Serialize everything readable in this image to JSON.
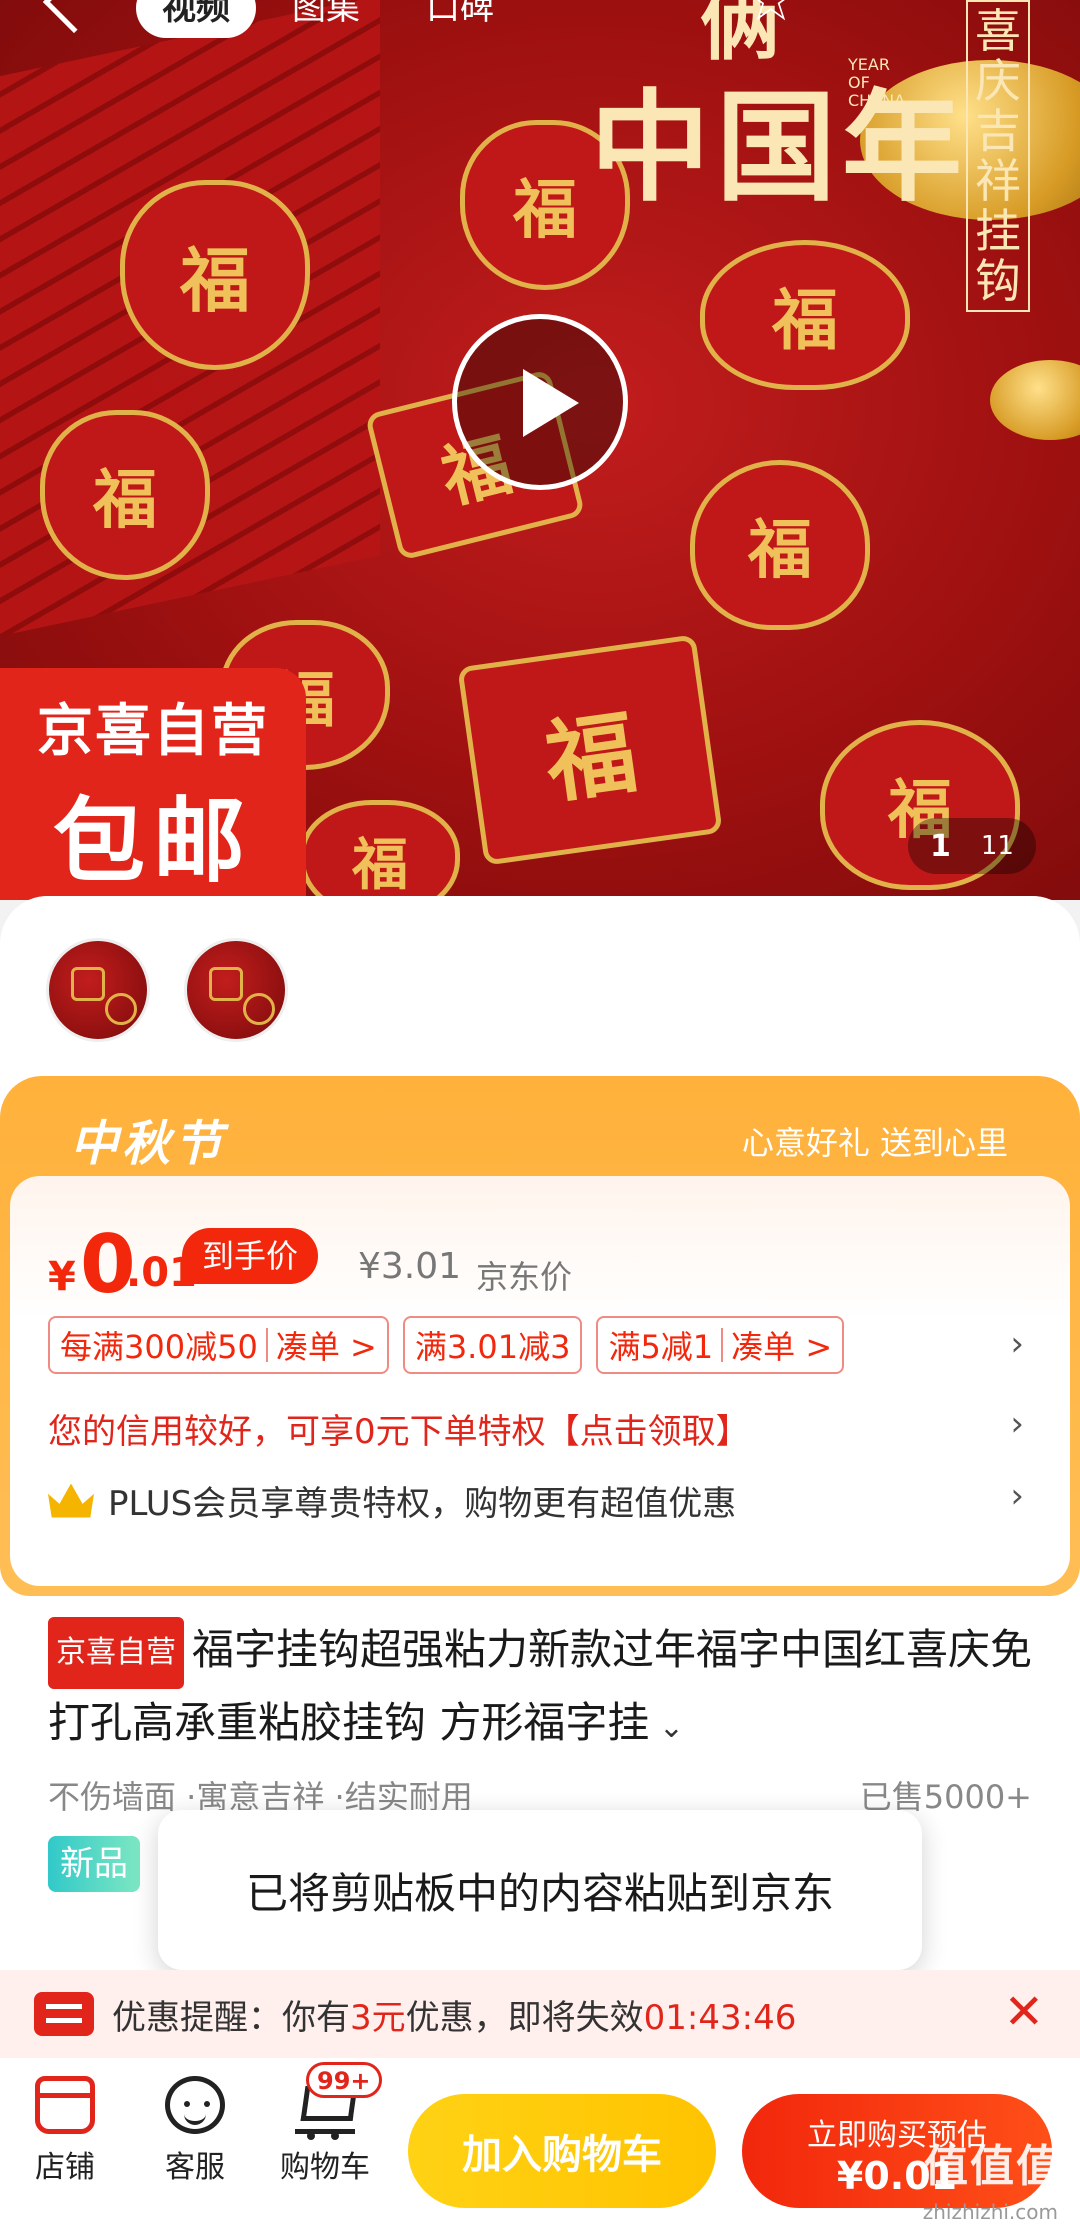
{
  "nav": {
    "tabs": [
      "视频",
      "图集",
      "口碑"
    ]
  },
  "hero": {
    "title_line1": "俩",
    "title_line2": "中国年",
    "year_text": "YEAR OF CHANA",
    "vertical_text": "喜庆吉祥挂钩",
    "fu_char": "福",
    "badge_line1": "京喜自营",
    "badge_line2": "包邮",
    "image_index": "1",
    "image_total": "11"
  },
  "festival": {
    "title": "中秋节",
    "slogan": "心意好礼 送到心里"
  },
  "price": {
    "currency": "¥",
    "integer": "0",
    "decimal": ".01",
    "tag": "到手价",
    "jd_price": "¥3.01",
    "jd_price_label": "京东价"
  },
  "coupons": [
    {
      "label": "每满300减50",
      "action": "凑单 >"
    },
    {
      "label": "满3.01减3"
    },
    {
      "label": "满5减1",
      "action": "凑单 >"
    }
  ],
  "credit_text": "您的信用较好，可享0元下单特权【点击领取】",
  "plus_text": "PLUS会员享尊贵特权，购物更有超值优惠",
  "product": {
    "tag": "京喜自营",
    "title": "福字挂钩超强粘力新款过年福字中国红喜庆免打孔高承重粘胶挂钩 方形福字挂",
    "features": "不伤墙面 ·寓意吉祥 ·结实耐用",
    "sold": "已售5000+",
    "new_tag": "新品"
  },
  "toast": "已将剪贴板中的内容粘贴到京东",
  "reminder": {
    "prefix": "优惠提醒：你有",
    "amount": "3元",
    "middle": "优惠，即将失效",
    "countdown": "01:43:46"
  },
  "bottom": {
    "shop": "店铺",
    "service": "客服",
    "cart": "购物车",
    "cart_badge": "99+",
    "add_to_cart": "加入购物车",
    "buy_line1": "立即购买预估",
    "buy_line2": "¥0.01"
  },
  "watermark": {
    "text": "值值值",
    "url": "zhizhizhi.com"
  },
  "colors": {
    "jd_red": "#e1251b",
    "festival_orange": "#ffb13b",
    "cart_yellow": "#ffd215"
  }
}
